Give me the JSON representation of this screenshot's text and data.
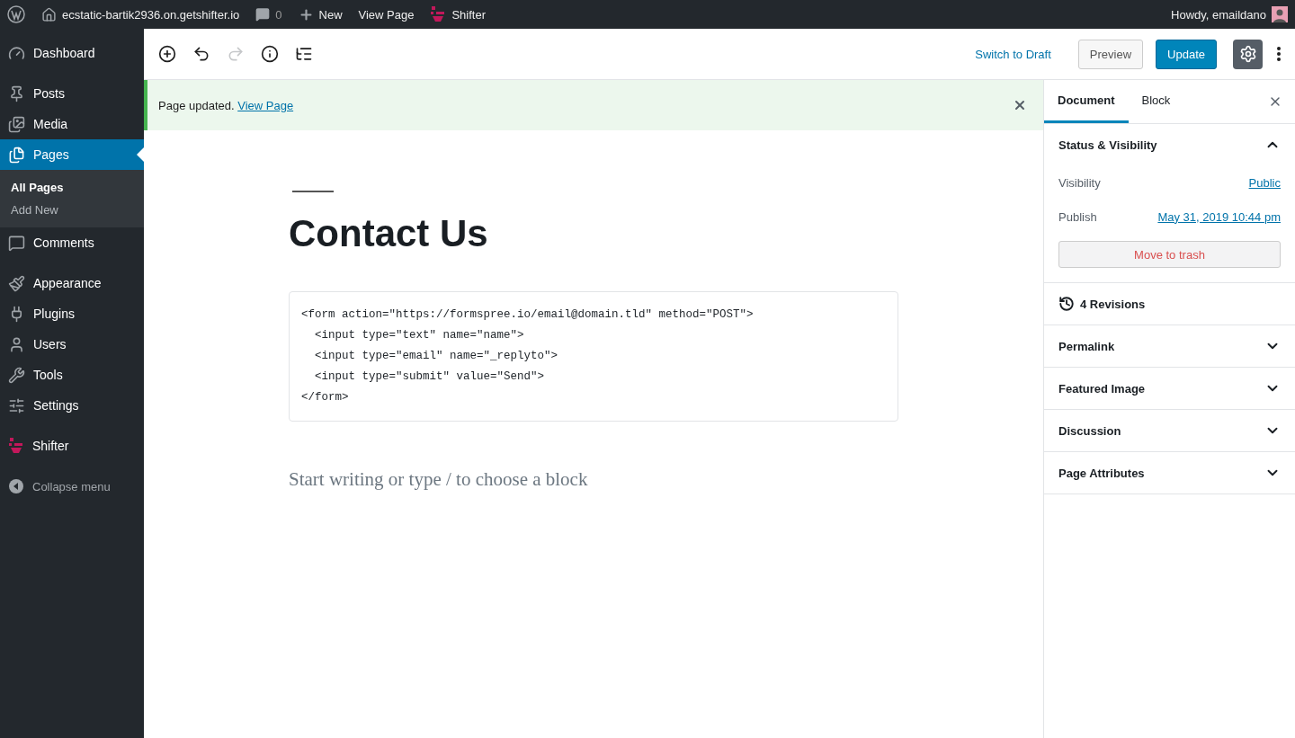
{
  "admin_bar": {
    "site": "ecstatic-bartik2936.on.getshifter.io",
    "comments_count": "0",
    "new": "New",
    "view_page": "View Page",
    "shifter": "Shifter",
    "greeting": "Howdy, emaildano"
  },
  "menu": {
    "groups": [
      {
        "items": [
          {
            "label": "Dashboard",
            "selected": false
          }
        ]
      },
      {
        "items": [
          {
            "label": "Posts",
            "selected": false
          },
          {
            "label": "Media",
            "selected": false
          },
          {
            "label": "Pages",
            "selected": true,
            "children": [
              {
                "label": "All Pages",
                "selected": true
              },
              {
                "label": "Add New",
                "selected": false
              }
            ]
          },
          {
            "label": "Comments",
            "selected": false
          }
        ]
      },
      {
        "items": [
          {
            "label": "Appearance",
            "selected": false
          },
          {
            "label": "Plugins",
            "selected": false
          },
          {
            "label": "Users",
            "selected": false
          },
          {
            "label": "Tools",
            "selected": false
          },
          {
            "label": "Settings",
            "selected": false
          }
        ]
      },
      {
        "items": [
          {
            "label": "Shifter",
            "selected": false
          }
        ]
      }
    ],
    "collapse": "Collapse menu"
  },
  "toolbar": {
    "redo_disabled": true,
    "switch_to_draft": "Switch to Draft",
    "preview": "Preview",
    "update": "Update",
    "settings_open": true
  },
  "notice": {
    "text": "Page updated.",
    "link": "View Page"
  },
  "editor": {
    "title": "Contact Us",
    "code": [
      "<form action=\"https://formspree.io/email@domain.tld\" method=\"POST\">",
      "  <input type=\"text\" name=\"name\">",
      "  <input type=\"email\" name=\"_replyto\">",
      "  <input type=\"submit\" value=\"Send\">",
      "</form>"
    ],
    "placeholder": "Start writing or type / to choose a block"
  },
  "settings_sidebar": {
    "tabs": [
      {
        "label": "Document",
        "selected": true
      },
      {
        "label": "Block",
        "selected": false
      }
    ],
    "status": {
      "title": "Status & Visibility",
      "expanded": true,
      "rows": [
        {
          "label": "Visibility",
          "value": "Public"
        },
        {
          "label": "Publish",
          "value": "May 31, 2019 10:44 pm"
        }
      ],
      "trash": "Move to trash"
    },
    "revisions": "4 Revisions",
    "sections": [
      {
        "title": "Permalink",
        "expanded": false
      },
      {
        "title": "Featured Image",
        "expanded": false
      },
      {
        "title": "Discussion",
        "expanded": false
      },
      {
        "title": "Page Attributes",
        "expanded": false
      }
    ]
  }
}
